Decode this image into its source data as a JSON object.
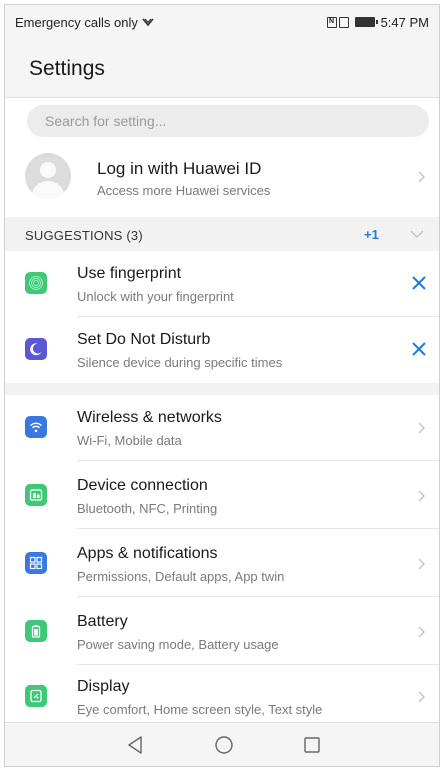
{
  "status_bar": {
    "carrier": "Emergency calls only",
    "time": "5:47 PM",
    "nfc_label": "N"
  },
  "header": {
    "title": "Settings"
  },
  "search": {
    "placeholder": "Search for setting..."
  },
  "account": {
    "title": "Log in with Huawei ID",
    "subtitle": "Access more Huawei services"
  },
  "suggestions": {
    "title": "SUGGESTIONS (3)",
    "more_count": "+1",
    "items": [
      {
        "title": "Use fingerprint",
        "subtitle": "Unlock with your fingerprint",
        "icon": "fingerprint-icon",
        "color": "#3ec878"
      },
      {
        "title": "Set Do Not Disturb",
        "subtitle": "Silence device during specific times",
        "icon": "moon-icon",
        "color": "#5b58d6"
      }
    ]
  },
  "settings": {
    "items": [
      {
        "title": "Wireless & networks",
        "subtitle": "Wi-Fi, Mobile data",
        "icon": "wifi-icon",
        "color": "#3a78e0"
      },
      {
        "title": "Device connection",
        "subtitle": "Bluetooth, NFC, Printing",
        "icon": "device-connection-icon",
        "color": "#3ec878"
      },
      {
        "title": "Apps & notifications",
        "subtitle": "Permissions, Default apps, App twin",
        "icon": "apps-grid-icon",
        "color": "#3a78e0"
      },
      {
        "title": "Battery",
        "subtitle": "Power saving mode, Battery usage",
        "icon": "battery-icon",
        "color": "#3ec878"
      },
      {
        "title": "Display",
        "subtitle": "Eye comfort, Home screen style, Text style",
        "icon": "display-icon",
        "color": "#3ec878"
      }
    ]
  },
  "colors": {
    "accent": "#1e7be3",
    "background": "#ffffff",
    "section_bg": "#f2f2f2"
  }
}
